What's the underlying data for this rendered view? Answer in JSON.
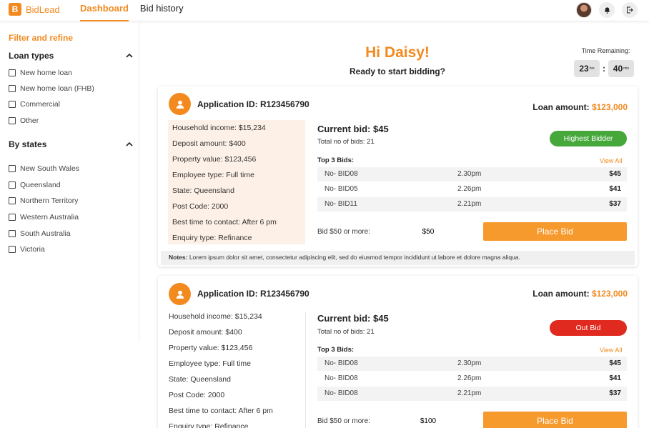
{
  "header": {
    "logo_letter": "B",
    "logo_text": "BidLead",
    "tabs": [
      {
        "label": "Dashboard",
        "active": true
      },
      {
        "label": "Bid history",
        "active": false
      }
    ],
    "icons": [
      "user-avatar",
      "bell-icon",
      "logout-icon"
    ]
  },
  "sidebar": {
    "filter_title": "Filter and refine",
    "loan_types": {
      "title": "Loan types",
      "items": [
        "New home loan",
        "New home loan (FHB)",
        "Commercial",
        "Other"
      ]
    },
    "states": {
      "title": "By states",
      "items": [
        "New South Wales",
        "Queensland",
        "Northern Territory",
        "Western Australia",
        "South Australia",
        "Victoria"
      ]
    }
  },
  "main": {
    "greeting": "Hi Daisy!",
    "subgreeting": "Ready to start bidding?",
    "timer": {
      "label": "Time Remaining:",
      "hours": "23",
      "hours_unit": "hrs",
      "minutes": "40",
      "minutes_unit": "min"
    },
    "cards": [
      {
        "application_id": "Application ID: R123456790",
        "loan_amount_label": "Loan amount: ",
        "loan_amount_value": "$123,000",
        "details": [
          "Household income: $15,234",
          "Deposit amount: $400",
          "Property value: $123,456",
          "Employee type: Full time",
          "State: Queensland",
          "Post Code: 2000",
          "Best time to contact: After 6 pm",
          "Enquiry type: Refinance"
        ],
        "current_bid": "Current bid: $45",
        "total_bids": "Total no of bids: 21",
        "badge": "Highest Bidder",
        "top3_label": "Top 3 Bids:",
        "view_all": "View All",
        "bids": [
          {
            "id": "No- BID08",
            "time": "2.30pm",
            "amount": "$45"
          },
          {
            "id": "No- BID05",
            "time": "2.26pm",
            "amount": "$41"
          },
          {
            "id": "No- BID11",
            "time": "2.21pm",
            "amount": "$37"
          }
        ],
        "bid_min_label": "Bid $50 or more:",
        "bid_input_value": "$50",
        "place_bid": "Place Bid",
        "notes_label": "Notes:",
        "notes_text": "Lorem ipsum dolor sit amet, consectetur adipiscing elit, sed do eiusmod tempor incididunt ut labore et dolore magna aliqua."
      },
      {
        "application_id": "Application ID: R123456790",
        "loan_amount_label": "Loan amount: ",
        "loan_amount_value": "$123,000",
        "details": [
          "Household income: $15,234",
          "Deposit amount: $400",
          "Property value: $123,456",
          "Employee type: Full time",
          "State: Queensland",
          "Post Code: 2000",
          "Best time to contact: After 6 pm",
          "Enquiry type: Refinance"
        ],
        "current_bid": "Current bid: $45",
        "total_bids": "Total no of bids: 21",
        "badge": "Out Bid",
        "top3_label": "Top 3 Bids:",
        "view_all": "View All",
        "bids": [
          {
            "id": "No- BID08",
            "time": "2.30pm",
            "amount": "$45"
          },
          {
            "id": "No- BID08",
            "time": "2.26pm",
            "amount": "$41"
          },
          {
            "id": "No- BID08",
            "time": "2.21pm",
            "amount": "$37"
          }
        ],
        "bid_min_label": "Bid $50 or more:",
        "bid_input_value": "$100",
        "place_bid": "Place Bid"
      }
    ]
  },
  "colors": {
    "accent": "#f28a1f",
    "button": "#f79a2e",
    "highest_bidder": "#46a83b",
    "out_bid": "#e02a1f",
    "detail_panel": "#fdf0e6"
  }
}
